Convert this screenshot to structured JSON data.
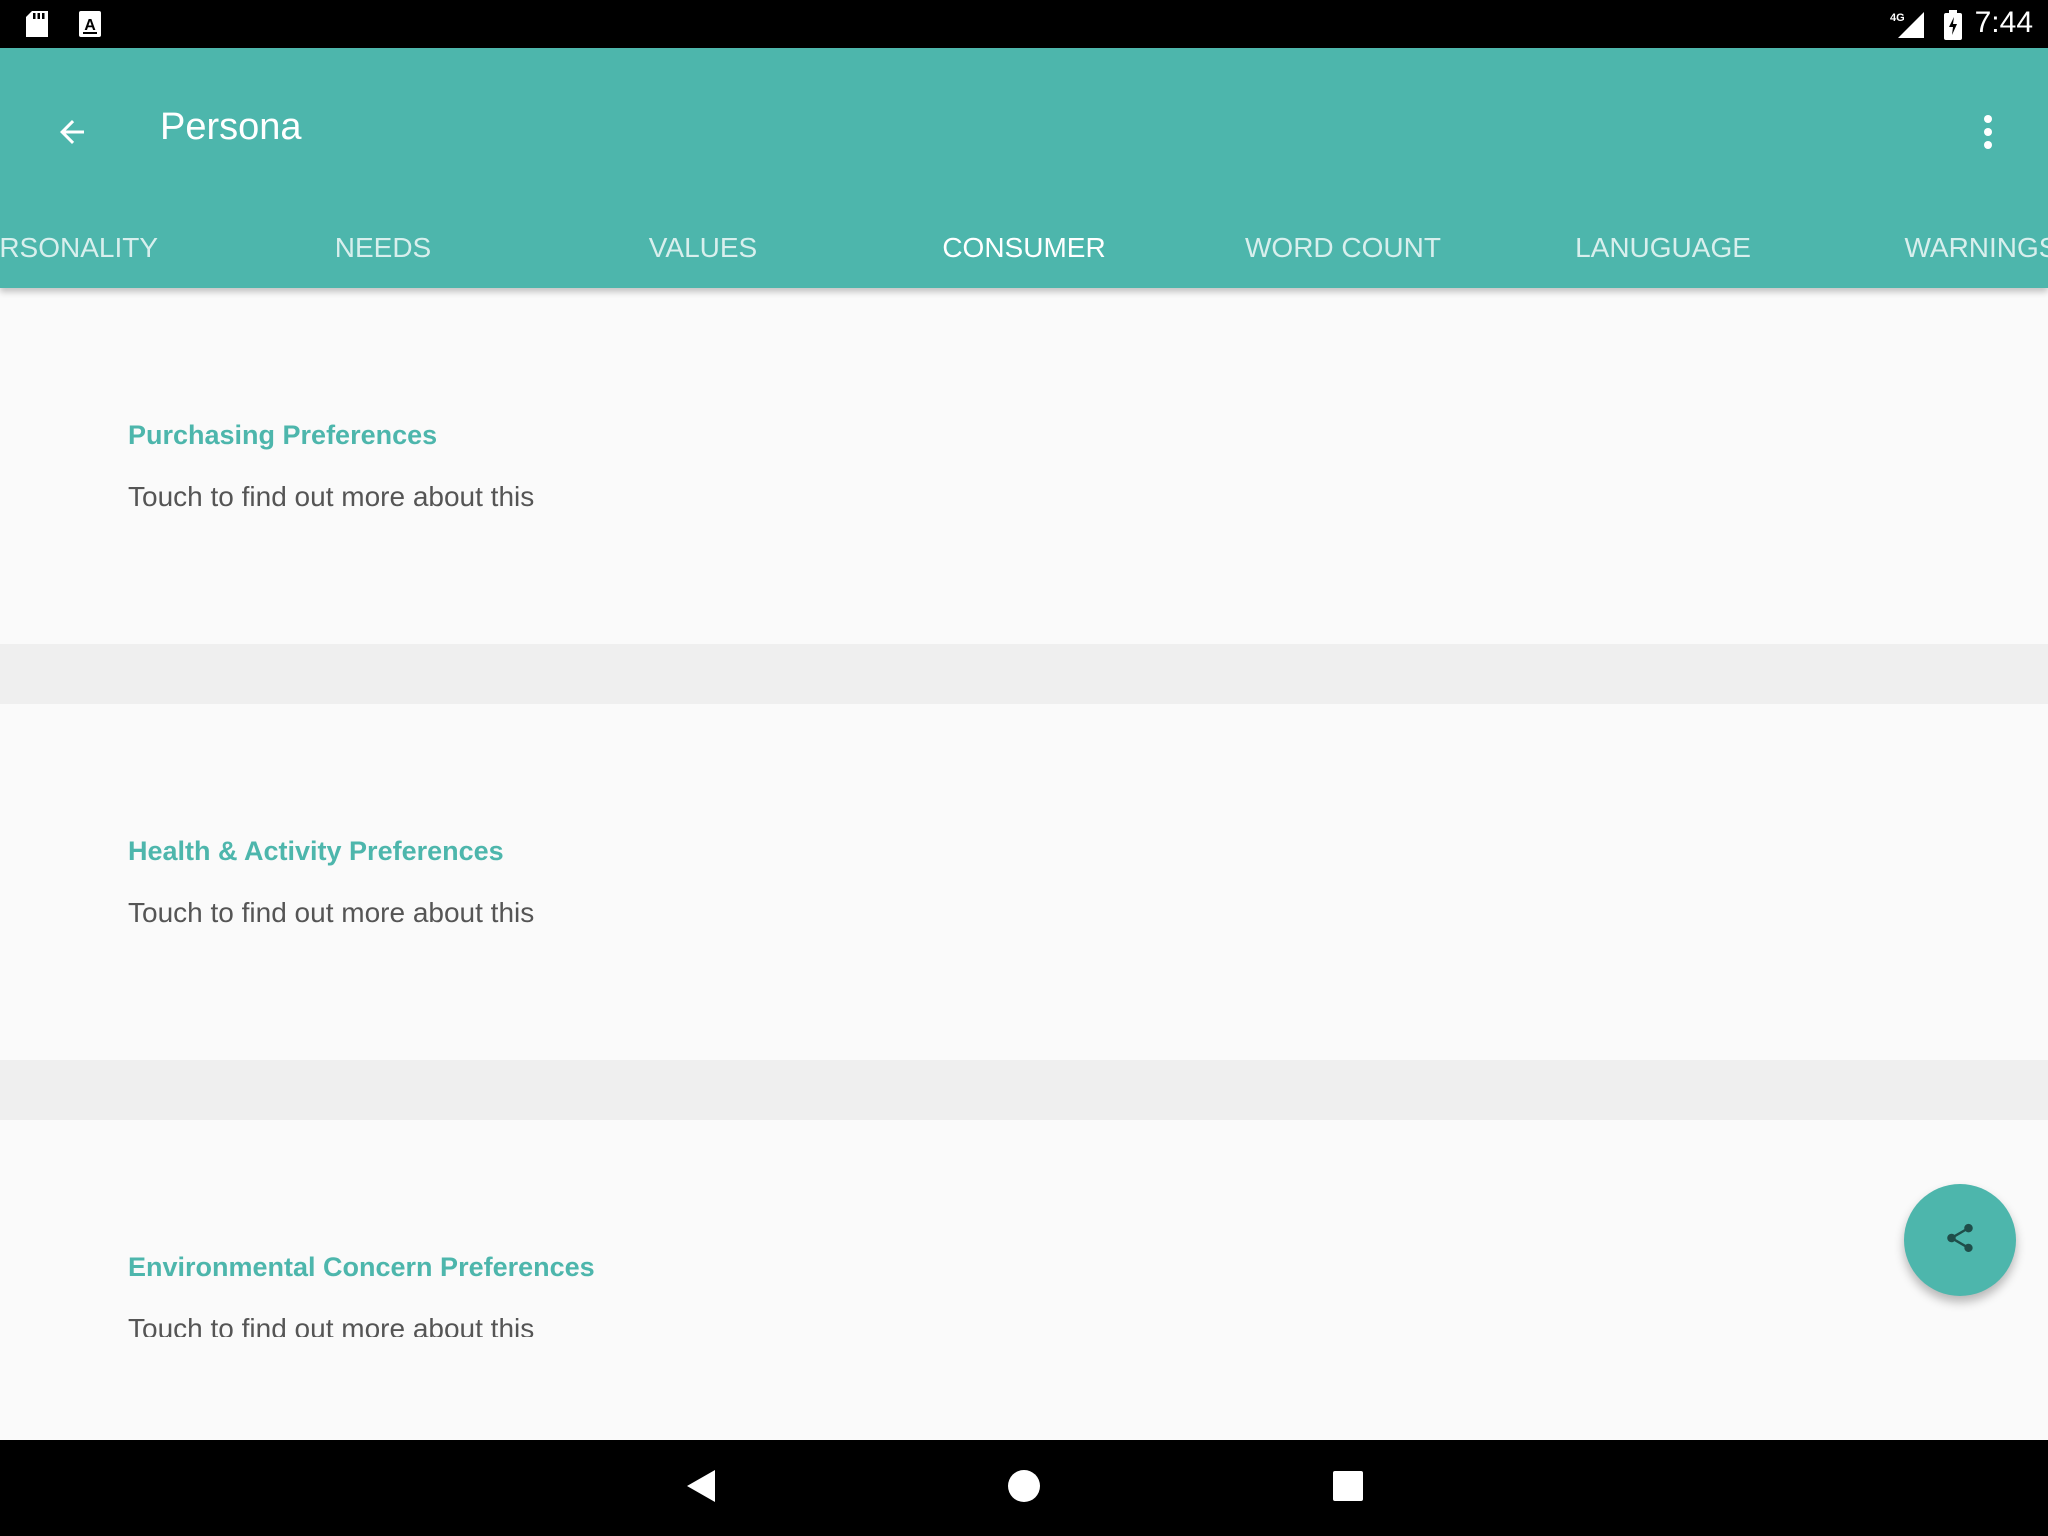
{
  "status_bar": {
    "time": "7:44",
    "network": "4G",
    "icons": [
      "sd-card-icon",
      "a-keyboard-icon",
      "signal-4g-icon",
      "battery-charging-icon"
    ]
  },
  "app_bar": {
    "title": "Persona",
    "back_icon": "arrow-back-icon",
    "more_icon": "more-vert-icon",
    "background": "#4db6ac"
  },
  "tabs": [
    {
      "label": "PERSONALITY",
      "active": false
    },
    {
      "label": "NEEDS",
      "active": false
    },
    {
      "label": "VALUES",
      "active": false
    },
    {
      "label": "CONSUMER",
      "active": true
    },
    {
      "label": "WORD COUNT",
      "active": false
    },
    {
      "label": "LANUGUAGE",
      "active": false
    },
    {
      "label": "WARNINGS",
      "active": false
    }
  ],
  "cards": [
    {
      "title": "Purchasing Preferences",
      "subtitle": "Touch to find out more about this"
    },
    {
      "title": "Health & Activity Preferences",
      "subtitle": "Touch to find out more about this"
    },
    {
      "title": "Environmental Concern Preferences",
      "subtitle": "Touch to find out more about this"
    }
  ],
  "fab": {
    "icon": "share-icon"
  },
  "nav_bar": {
    "icons": [
      "nav-back-icon",
      "nav-home-icon",
      "nav-recents-icon"
    ]
  },
  "colors": {
    "accent": "#4db6ac",
    "divider": "#efefef",
    "background": "#fafafa",
    "text_secondary": "#555555"
  }
}
